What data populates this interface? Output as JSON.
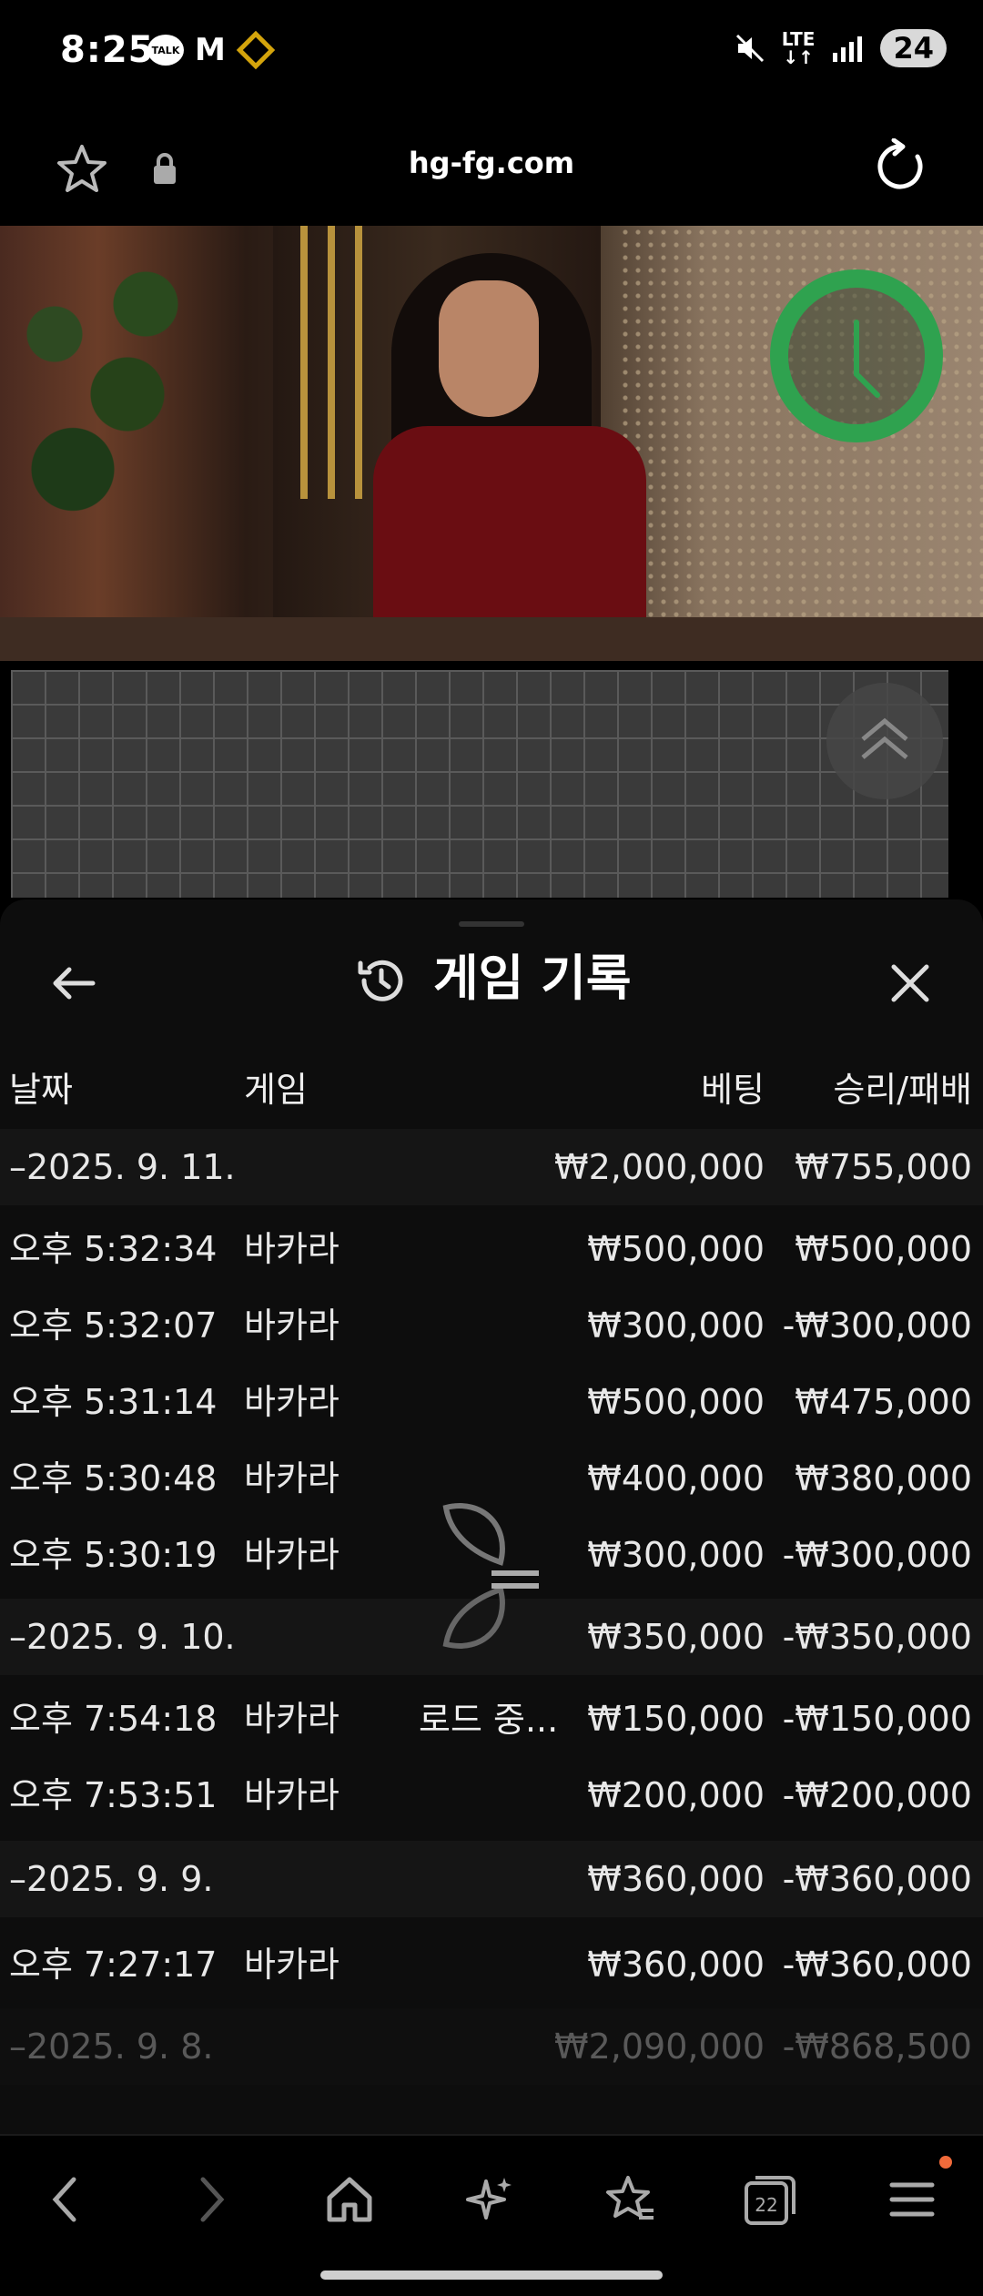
{
  "status_bar": {
    "time": "8:25",
    "talk_label": "TALK",
    "mail_glyph": "M",
    "network": "LTE",
    "battery": "24"
  },
  "browser": {
    "url": "hg-fg.com"
  },
  "sheet": {
    "title": "게임 기록",
    "columns": {
      "date": "날짜",
      "game": "게임",
      "bet": "베팅",
      "win_loss": "승리/패배"
    },
    "loading_text": "로드 중...",
    "rows": [
      {
        "type": "date",
        "date": "–2025. 9. 11.",
        "game": "",
        "bet": "₩2,000,000",
        "win_loss": "₩755,000"
      },
      {
        "type": "game",
        "date": "오후 5:32:34",
        "game": "바카라",
        "bet": "₩500,000",
        "win_loss": "₩500,000"
      },
      {
        "type": "game",
        "date": "오후 5:32:07",
        "game": "바카라",
        "bet": "₩300,000",
        "win_loss": "-₩300,000"
      },
      {
        "type": "game",
        "date": "오후 5:31:14",
        "game": "바카라",
        "bet": "₩500,000",
        "win_loss": "₩475,000"
      },
      {
        "type": "game",
        "date": "오후 5:30:48",
        "game": "바카라",
        "bet": "₩400,000",
        "win_loss": "₩380,000"
      },
      {
        "type": "game",
        "date": "오후 5:30:19",
        "game": "바카라",
        "bet": "₩300,000",
        "win_loss": "-₩300,000"
      },
      {
        "type": "date",
        "date": "–2025. 9. 10.",
        "game": "",
        "bet": "₩350,000",
        "win_loss": "-₩350,000"
      },
      {
        "type": "game",
        "date": "오후 7:54:18",
        "game": "바카라",
        "bet": "₩150,000",
        "win_loss": "-₩150,000"
      },
      {
        "type": "game",
        "date": "오후 7:53:51",
        "game": "바카라",
        "bet": "₩200,000",
        "win_loss": "-₩200,000"
      },
      {
        "type": "date",
        "date": "–2025. 9. 9.",
        "game": "",
        "bet": "₩360,000",
        "win_loss": "-₩360,000"
      },
      {
        "type": "game",
        "date": "오후 7:27:17",
        "game": "바카라",
        "bet": "₩360,000",
        "win_loss": "-₩360,000"
      },
      {
        "type": "date",
        "date": "–2025. 9. 8.",
        "game": "",
        "bet": "₩2,090,000",
        "win_loss": "-₩868,500"
      }
    ]
  },
  "bottom_nav": {
    "tabs_count": "22"
  },
  "colors": {
    "timer_green": "#2fa24f",
    "notification_dot": "#f06a3a",
    "background": "#000000"
  }
}
